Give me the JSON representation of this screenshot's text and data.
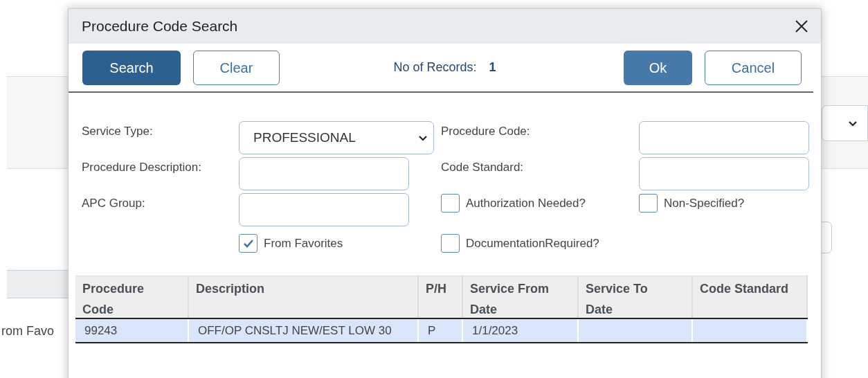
{
  "background_page": {
    "partial_text": "rom Favo"
  },
  "dialog": {
    "title": "Procedure Code Search",
    "toolbar": {
      "search_button": {
        "label": "Search"
      },
      "clear_button": {
        "label": "Clear"
      },
      "records_label": "No of Records:",
      "records_count": "1",
      "ok_button": {
        "label": "Ok"
      },
      "cancel_button": {
        "label": "Cancel"
      }
    },
    "form": {
      "service_type": {
        "label": "Service Type:",
        "value": "PROFESSIONAL"
      },
      "procedure_description": {
        "label": "Procedure Description:"
      },
      "apc_group": {
        "label": "APC Group:"
      },
      "from_favorites": {
        "label": "From Favorites",
        "checked": true
      },
      "procedure_code": {
        "label": "Procedure Code:"
      },
      "code_standard": {
        "label": "Code Standard:"
      },
      "authorization_needed": {
        "label": "Authorization Needed?",
        "checked": false
      },
      "non_specified": {
        "label": "Non-Specified?",
        "checked": false
      },
      "documentation_required": {
        "label": "DocumentationRequired?",
        "checked": false
      }
    },
    "table": {
      "columns": [
        "Procedure Code",
        "Description",
        "P/H",
        "Service From Date",
        "Service To Date",
        "Code Standard"
      ],
      "rows": [
        {
          "selected": true,
          "cells": [
            "99243",
            "OFF/OP CNSLTJ NEW/EST LOW 30",
            "P",
            "1/1/2023"
          ]
        }
      ]
    }
  }
}
